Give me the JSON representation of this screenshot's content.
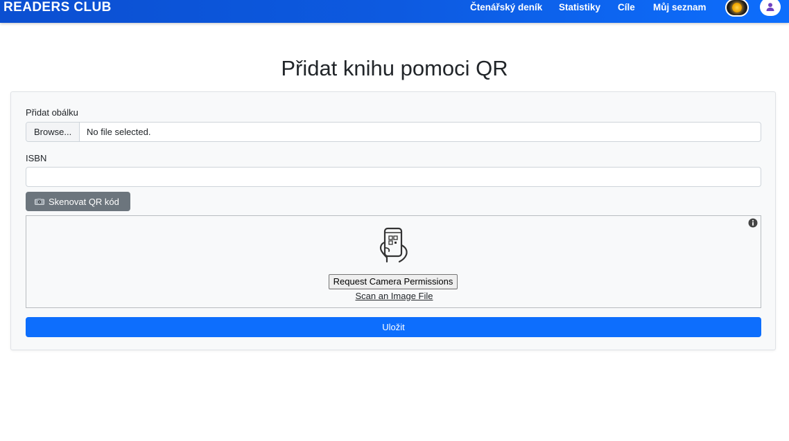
{
  "navbar": {
    "brand": "READERS CLUB",
    "links": [
      "Čtenářský deník",
      "Statistiky",
      "Cíle",
      "Můj seznam"
    ]
  },
  "page_title": "Přidat knihu pomoci QR",
  "form": {
    "cover_label": "Přidat obálku",
    "browse_label": "Browse...",
    "file_status": "No file selected.",
    "isbn_label": "ISBN",
    "isbn_value": "",
    "scan_button_label": "Skenovat QR kód",
    "scanner": {
      "request_permissions_label": "Request Camera Permissions",
      "scan_file_link": "Scan an Image File"
    },
    "save_button_label": "Uložit"
  },
  "colors": {
    "navbar": "#0d6efd",
    "primary": "#0d6efd",
    "secondary": "#6c757d",
    "card_bg": "#f8f9fa"
  },
  "icons": [
    "sun-icon",
    "user-icon",
    "camera-icon",
    "info-icon",
    "phone-qr-icon"
  ]
}
